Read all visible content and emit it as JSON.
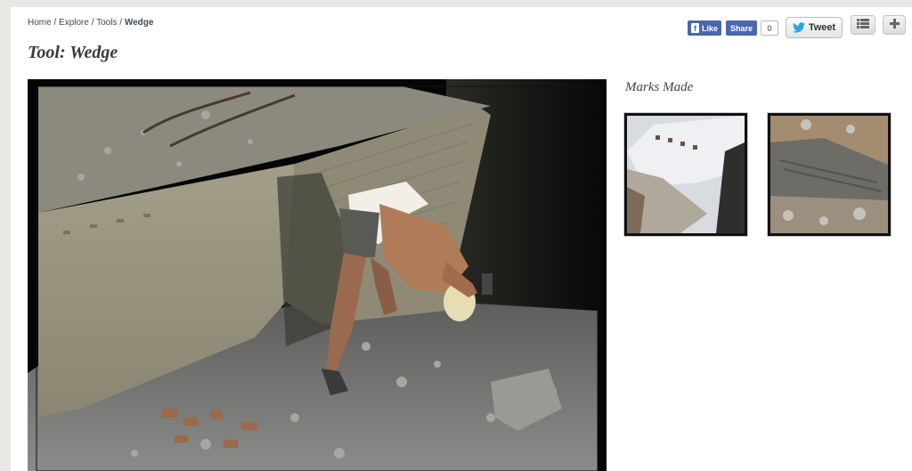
{
  "breadcrumb": {
    "home": "Home",
    "explore": "Explore",
    "tools": "Tools",
    "current": "Wedge",
    "separator": "/"
  },
  "title": "Tool: Wedge",
  "social": {
    "fb_like_label": "Like",
    "fb_share_label": "Share",
    "fb_count": "0",
    "tweet_label": "Tweet",
    "icons": [
      "facebook-icon",
      "twitter-bird-icon",
      "list-view-icon",
      "plus-icon"
    ]
  },
  "main_image": {
    "alt": "Worker bent over using a wedge beside a large quarried stone block",
    "icon": "photo"
  },
  "sidebar": {
    "heading": "Marks Made",
    "thumbnails": [
      {
        "alt": "Stone block face with a row of wedge holes"
      },
      {
        "alt": "Split stone block showing wedge marks along its edge"
      }
    ]
  },
  "colors": {
    "facebook_blue": "#4a66ad",
    "twitter_blue": "#2aa3ef",
    "page_bg": "#e9e8e4",
    "title_text": "#3a3a3a"
  }
}
